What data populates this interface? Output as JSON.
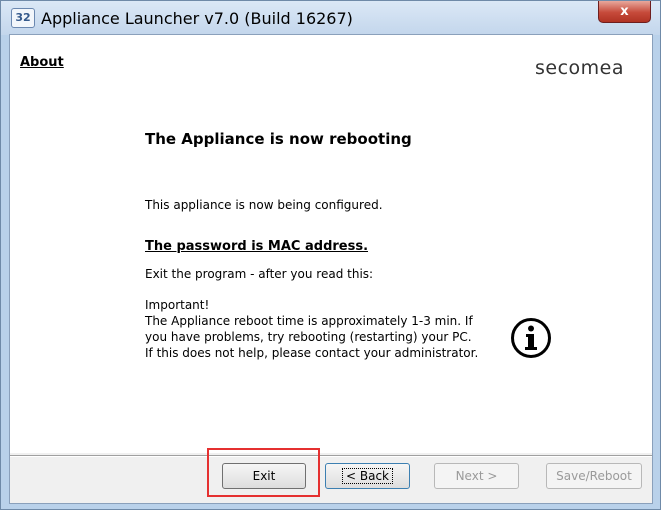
{
  "window": {
    "title": "Appliance Launcher v7.0 (Build 16267)",
    "icon_label": "32",
    "close_label": "x"
  },
  "menu": {
    "about": "About"
  },
  "brand": "secomea",
  "content": {
    "heading": "The Appliance is now rebooting",
    "configuring": "This appliance is now being configured.",
    "password_note": "The password is MAC address.",
    "exit_note": "Exit the program - after you read this:",
    "important_lines": [
      "Important!",
      "The Appliance reboot time is approximately 1-3 min. If",
      "you have problems, try rebooting (restarting) your PC.",
      "If this does not help, please contact your administrator."
    ],
    "info_icon": "info-icon"
  },
  "buttons": {
    "exit": "Exit",
    "back": "< Back",
    "next": "Next >",
    "save_reboot": "Save/Reboot"
  },
  "colors": {
    "highlight": "#e53030",
    "close_button": "#c64a3a",
    "title_bar": "#c3d6ec"
  }
}
